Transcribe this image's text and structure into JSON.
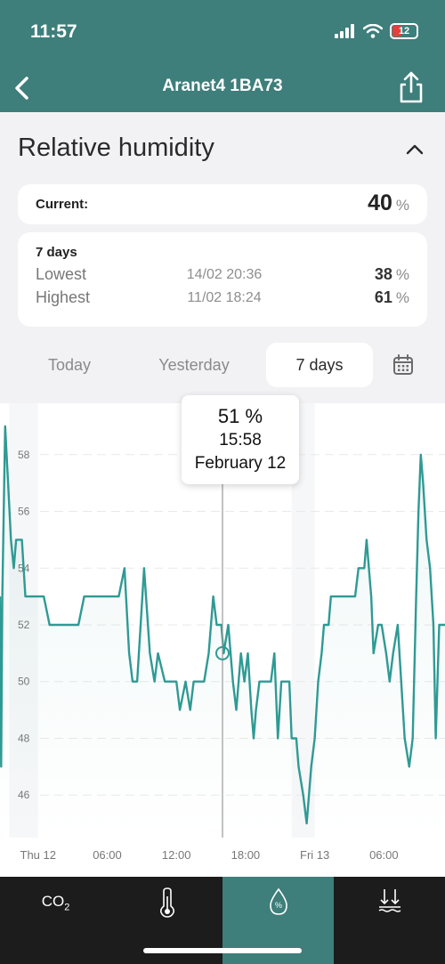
{
  "status_bar": {
    "time": "11:57",
    "battery": "12",
    "battery_color": "#e3403a"
  },
  "nav": {
    "title": "Aranet4 1BA73"
  },
  "section": {
    "title": "Relative humidity"
  },
  "current": {
    "label": "Current:",
    "value": "40",
    "unit": "%"
  },
  "stats": {
    "period": "7 days",
    "lowest": {
      "label": "Lowest",
      "time": "14/02 20:36",
      "value": "38",
      "unit": "%"
    },
    "highest": {
      "label": "Highest",
      "time": "11/02 18:24",
      "value": "61",
      "unit": "%"
    }
  },
  "tabs": [
    {
      "label": "Today",
      "active": false
    },
    {
      "label": "Yesterday",
      "active": false
    },
    {
      "label": "7 days",
      "active": true
    }
  ],
  "tooltip": {
    "value": "51 %",
    "time": "15:58",
    "date": "February 12"
  },
  "bottom_nav": [
    {
      "label": "CO",
      "sub": "2",
      "icon": "co2-icon",
      "active": false
    },
    {
      "label": "",
      "icon": "thermometer-icon",
      "active": false
    },
    {
      "label": "",
      "icon": "humidity-drop-icon",
      "active": true
    },
    {
      "label": "",
      "icon": "pressure-icon",
      "active": false
    }
  ],
  "colors": {
    "accent": "#3e7e7b",
    "line": "#2f9a94"
  },
  "chart_data": {
    "type": "line",
    "title": "",
    "xlabel": "",
    "ylabel": "",
    "ylim": [
      44.5,
      59.5
    ],
    "y_ticks": [
      46,
      48,
      50,
      52,
      54,
      56,
      58
    ],
    "x_ticks": [
      {
        "label": "Thu 12",
        "x": 0
      },
      {
        "label": "06:00",
        "x": 6
      },
      {
        "label": "12:00",
        "x": 12
      },
      {
        "label": "18:00",
        "x": 18
      },
      {
        "label": "Fri 13",
        "x": 24
      },
      {
        "label": "06:00",
        "x": 30
      }
    ],
    "xlim": [
      -3.3,
      35.3
    ],
    "x_unit": "hours from Thu 12 00:00",
    "selected_point": {
      "x": 16,
      "y": 51
    },
    "series": [
      {
        "points": [
          [
            -3.3,
            53
          ],
          [
            -3.2,
            47
          ],
          [
            -3.1,
            53
          ],
          [
            -2.85,
            59
          ],
          [
            -2.6,
            57
          ],
          [
            -2.35,
            55
          ],
          [
            -2.1,
            54
          ],
          [
            -1.9,
            55
          ],
          [
            -1.4,
            55
          ],
          [
            -1.1,
            53
          ],
          [
            -0.5,
            53
          ],
          [
            0.5,
            53
          ],
          [
            1.0,
            52
          ],
          [
            3.5,
            52
          ],
          [
            4.0,
            53
          ],
          [
            6.0,
            53
          ],
          [
            7.0,
            53
          ],
          [
            7.5,
            54
          ],
          [
            7.9,
            51
          ],
          [
            8.2,
            50
          ],
          [
            8.6,
            50
          ],
          [
            9.2,
            54
          ],
          [
            9.7,
            51
          ],
          [
            10.1,
            50
          ],
          [
            10.4,
            51
          ],
          [
            11.0,
            50
          ],
          [
            12.0,
            50
          ],
          [
            12.3,
            49
          ],
          [
            12.8,
            50
          ],
          [
            13.2,
            49
          ],
          [
            13.5,
            50
          ],
          [
            14.4,
            50
          ],
          [
            14.8,
            51
          ],
          [
            15.2,
            53
          ],
          [
            15.5,
            52
          ],
          [
            15.9,
            52
          ],
          [
            16.1,
            51
          ],
          [
            16.5,
            52
          ],
          [
            16.9,
            50
          ],
          [
            17.2,
            49
          ],
          [
            17.4,
            50
          ],
          [
            17.6,
            51
          ],
          [
            17.9,
            50
          ],
          [
            18.2,
            51
          ],
          [
            18.5,
            49
          ],
          [
            18.7,
            48
          ],
          [
            18.9,
            49
          ],
          [
            19.2,
            50
          ],
          [
            19.6,
            50
          ],
          [
            20.2,
            50
          ],
          [
            20.5,
            51
          ],
          [
            20.8,
            48
          ],
          [
            21.1,
            50
          ],
          [
            21.5,
            50
          ],
          [
            21.8,
            50
          ],
          [
            22.0,
            48
          ],
          [
            22.4,
            48
          ],
          [
            22.6,
            47
          ],
          [
            23.0,
            46
          ],
          [
            23.3,
            45
          ],
          [
            23.7,
            47
          ],
          [
            24.0,
            48
          ],
          [
            24.3,
            50
          ],
          [
            24.6,
            51
          ],
          [
            24.8,
            52
          ],
          [
            25.2,
            52
          ],
          [
            25.4,
            53
          ],
          [
            26.0,
            53
          ],
          [
            26.2,
            53
          ],
          [
            27.5,
            53
          ],
          [
            27.8,
            54
          ],
          [
            28.3,
            54
          ],
          [
            28.5,
            55
          ],
          [
            28.9,
            53
          ],
          [
            29.1,
            51
          ],
          [
            29.5,
            52
          ],
          [
            29.8,
            52
          ],
          [
            30.2,
            51
          ],
          [
            30.5,
            50
          ],
          [
            30.8,
            51
          ],
          [
            31.2,
            52
          ],
          [
            31.5,
            50
          ],
          [
            31.8,
            48
          ],
          [
            32.2,
            47
          ],
          [
            32.5,
            48
          ],
          [
            32.8,
            53
          ],
          [
            33.0,
            56
          ],
          [
            33.2,
            58
          ],
          [
            33.4,
            57
          ],
          [
            33.7,
            55
          ],
          [
            34.0,
            54
          ],
          [
            34.3,
            52
          ],
          [
            34.5,
            48
          ],
          [
            34.8,
            52
          ],
          [
            35.3,
            52
          ]
        ]
      }
    ]
  }
}
